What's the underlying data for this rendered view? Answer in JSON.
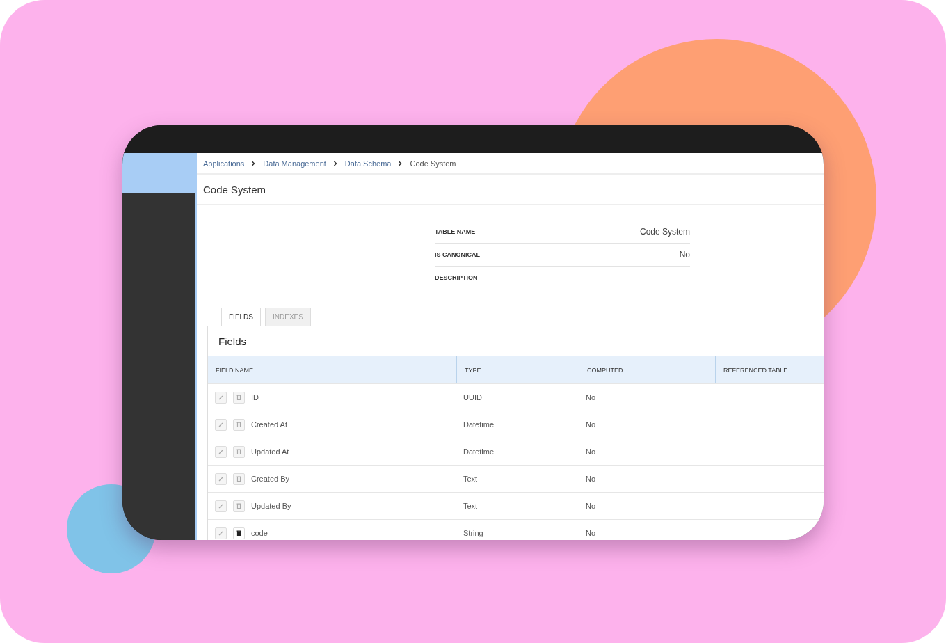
{
  "breadcrumb": [
    {
      "label": "Applications",
      "link": true
    },
    {
      "label": "Data Management",
      "link": true
    },
    {
      "label": "Data Schema",
      "link": true
    },
    {
      "label": "Code System",
      "link": false
    }
  ],
  "page_title": "Code System",
  "details": [
    {
      "label": "TABLE NAME",
      "value": "Code System"
    },
    {
      "label": "IS CANONICAL",
      "value": "No"
    },
    {
      "label": "DESCRIPTION"
    }
  ],
  "tabs": [
    {
      "label": "FIELDS",
      "selected": true
    },
    {
      "label": "INDEXES",
      "selected": false
    }
  ],
  "panel_title": "Fields",
  "table": {
    "columns": [
      "FIELD NAME",
      "TYPE",
      "COMPUTED",
      "REFERENCED TABLE"
    ],
    "rows": [
      {
        "name": "ID",
        "type": "UUID",
        "computed": "No",
        "delete_disabled": true
      },
      {
        "name": "Created At",
        "type": "Datetime",
        "computed": "No",
        "delete_disabled": true
      },
      {
        "name": "Updated At",
        "type": "Datetime",
        "computed": "No",
        "delete_disabled": true
      },
      {
        "name": "Created By",
        "type": "Text",
        "computed": "No",
        "delete_disabled": true
      },
      {
        "name": "Updated By",
        "type": "Text",
        "computed": "No",
        "delete_disabled": true
      },
      {
        "name": "code",
        "type": "String",
        "computed": "No",
        "delete_disabled": false
      }
    ]
  }
}
